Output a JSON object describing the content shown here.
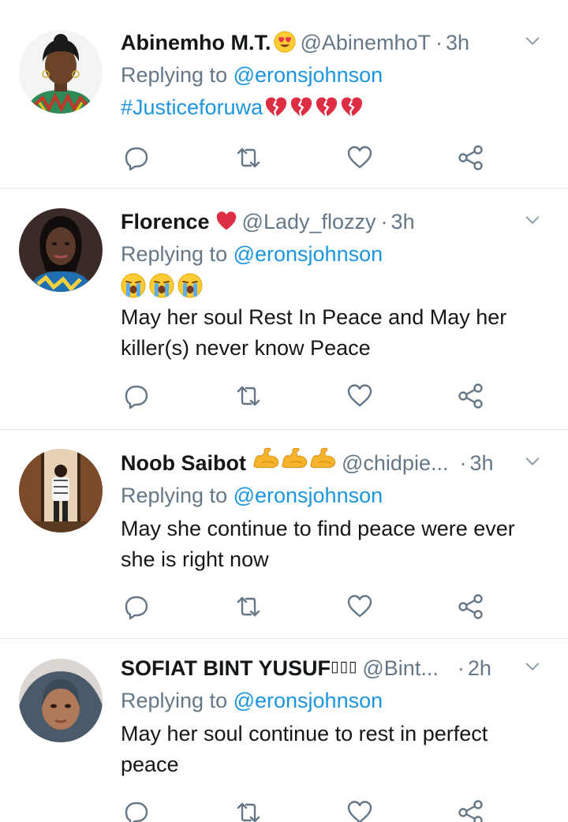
{
  "feed": {
    "tweets": [
      {
        "name": "Abinemho M.T.",
        "name_emoji": "heart-eyes-emoji",
        "handle": "@AbinemhoT",
        "time": "3h",
        "replying_prefix": "Replying to ",
        "replying_to": "@eronsjohnson",
        "hashtag": "#Justiceforuwa",
        "text_emoji": "broken-heart-emoji x4"
      },
      {
        "name": "Florence",
        "name_emoji": "red-heart-emoji",
        "handle": "@Lady_flozzy",
        "time": "3h",
        "replying_prefix": "Replying to ",
        "replying_to": "@eronsjohnson",
        "text_emoji": "crying-face-emoji x3",
        "text": "May her soul Rest In Peace and May her killer(s) never know Peace"
      },
      {
        "name": "Noob Saibot",
        "name_emoji": "flexed-biceps-emoji x3",
        "handle": "@chidpie...",
        "time": "3h",
        "replying_prefix": "Replying to ",
        "replying_to": "@eronsjohnson",
        "text": "May she continue to find peace were ever she is right now"
      },
      {
        "name": "SOFIAT BINT YUSUF",
        "name_suffix": "▯▯▯",
        "handle": "@Bint...",
        "time": "2h",
        "replying_prefix": "Replying to ",
        "replying_to": "@eronsjohnson",
        "text": "May her soul continue to rest in perfect peace"
      }
    ],
    "separator": "·",
    "icons": [
      "chevron-down-icon",
      "reply-icon",
      "retweet-icon",
      "like-icon",
      "share-icon"
    ],
    "colors": {
      "link": "#1b95e0",
      "secondary_text": "#657786",
      "primary_text": "#14171a",
      "divider": "#e1e8ed"
    }
  }
}
